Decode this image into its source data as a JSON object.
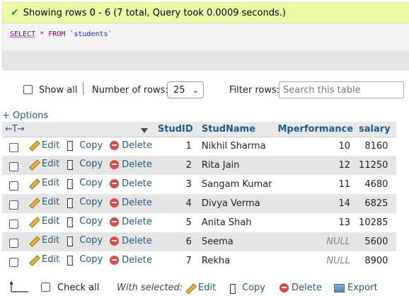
{
  "message": {
    "text": "Showing rows 0 - 6 (7 total, Query took 0.0009 seconds.)"
  },
  "sql": {
    "select": "SELECT",
    "star": "*",
    "from": "FROM",
    "table": "`students`"
  },
  "nav": {
    "show_all": "Show all",
    "number_of_rows_label": "Number of rows:",
    "rows_value": "25",
    "filter_label": "Filter rows:",
    "filter_placeholder": "Search this table"
  },
  "options_link": "+ Options",
  "table": {
    "columns": [
      "StudID",
      "StudName",
      "Mperformance",
      "salary"
    ],
    "actions": {
      "edit": "Edit",
      "copy": "Copy",
      "delete": "Delete"
    },
    "rows": [
      {
        "id": "1",
        "name": "Nikhil Sharma",
        "perf": "10",
        "salary": "8160"
      },
      {
        "id": "2",
        "name": "Rita Jain",
        "perf": "12",
        "salary": "11250"
      },
      {
        "id": "3",
        "name": "Sangam Kumar",
        "perf": "11",
        "salary": "4680"
      },
      {
        "id": "4",
        "name": "Divya Verma",
        "perf": "14",
        "salary": "6825"
      },
      {
        "id": "5",
        "name": "Anita Shah",
        "perf": "13",
        "salary": "10285"
      },
      {
        "id": "6",
        "name": "Seema",
        "perf": "NULL",
        "salary": "5600"
      },
      {
        "id": "7",
        "name": "Rekha",
        "perf": "NULL",
        "salary": "8900"
      }
    ]
  },
  "footer": {
    "check_all": "Check all",
    "with_selected": "With selected:",
    "edit": "Edit",
    "copy": "Copy",
    "delete": "Delete",
    "export": "Export"
  }
}
